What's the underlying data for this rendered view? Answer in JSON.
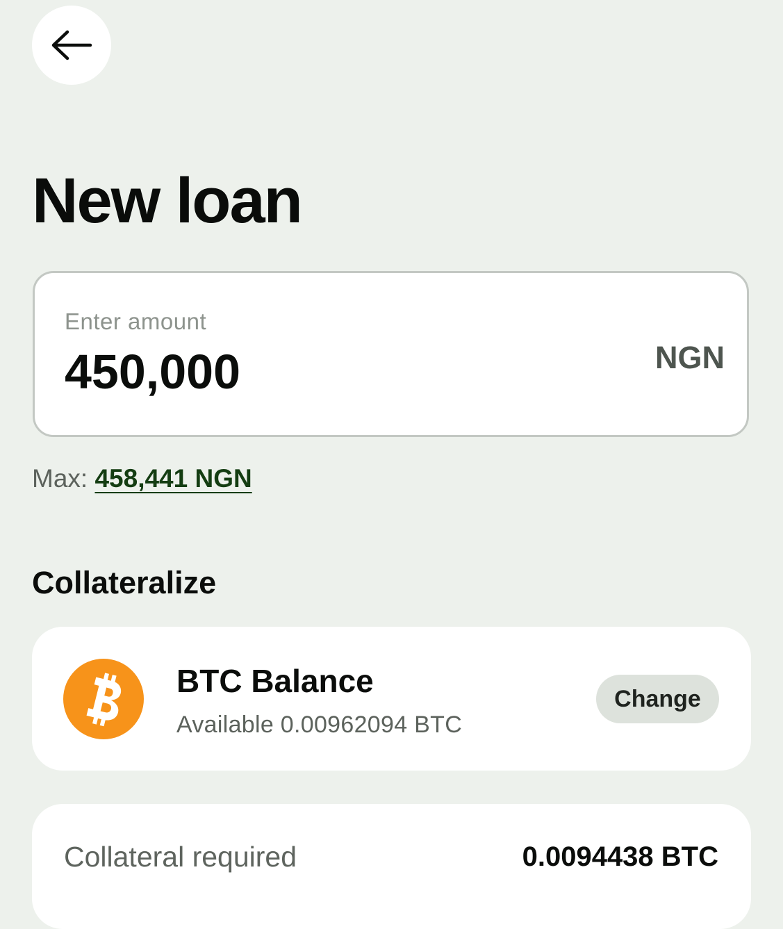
{
  "header": {
    "back_icon": "arrow-left-icon",
    "title": "New loan"
  },
  "amount": {
    "label": "Enter amount",
    "value": "450,000",
    "currency": "NGN"
  },
  "max": {
    "prefix": "Max:",
    "value": "458,441 NGN"
  },
  "collateralize": {
    "title": "Collateralize",
    "asset_icon": "bitcoin-icon",
    "asset_title": "BTC Balance",
    "available": "Available 0.00962094 BTC",
    "change_label": "Change"
  },
  "summary": {
    "collateral_label": "Collateral required",
    "collateral_value": "0.0094438 BTC"
  },
  "colors": {
    "background": "#edf1ec",
    "card": "#ffffff",
    "bitcoin": "#f7931a",
    "max_link": "#143d12",
    "change_button": "#dde2dc"
  }
}
